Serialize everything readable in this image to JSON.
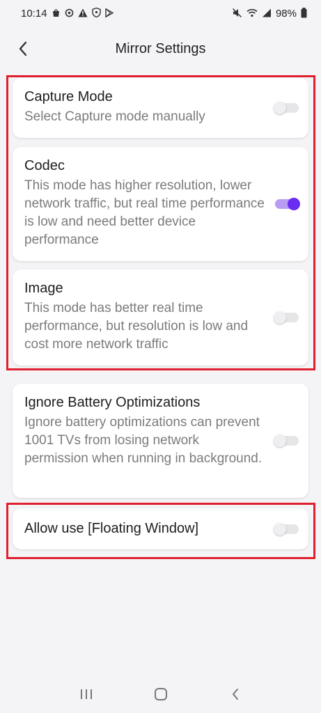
{
  "status_bar": {
    "time": "10:14",
    "battery": "98%"
  },
  "header": {
    "title": "Mirror Settings"
  },
  "settings": [
    {
      "title": "Capture Mode",
      "description": "Select Capture mode manually",
      "enabled": false
    },
    {
      "title": "Codec",
      "description": "This mode has higher resolution, lower network traffic, but real time performance is low and need better device performance",
      "enabled": true
    },
    {
      "title": "Image",
      "description": "This mode has better real time performance, but resolution is low and cost more network traffic",
      "enabled": false
    },
    {
      "title": "Ignore Battery Optimizations",
      "description": "Ignore battery optimizations can prevent 1001 TVs from losing network permission when running in background.",
      "enabled": false
    },
    {
      "title": "Allow use [Floating Window]",
      "enabled": false
    }
  ],
  "colors": {
    "accent": "#6a2cf0",
    "highlight_box": "#e0202e"
  },
  "icons": {
    "status_left": [
      "notification-bag-icon",
      "sync-icon",
      "warning-icon",
      "shield-icon",
      "play-store-icon"
    ],
    "status_right": [
      "mute-icon",
      "wifi-icon",
      "signal-icon",
      "battery-icon"
    ],
    "navigation": [
      "recent-apps-icon",
      "home-icon",
      "back-nav-icon"
    ]
  }
}
